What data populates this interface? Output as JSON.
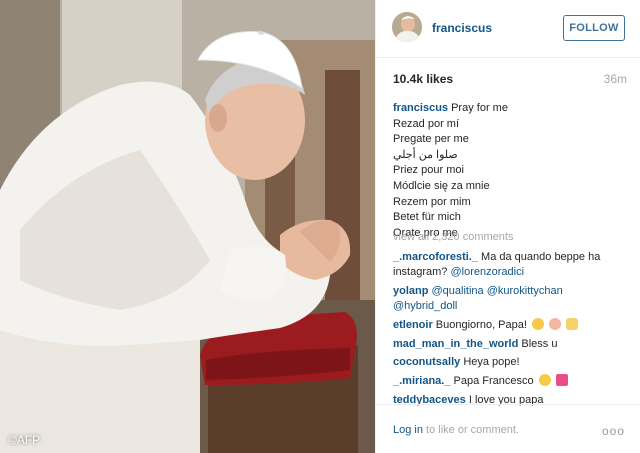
{
  "photo": {
    "credit": "©AFP"
  },
  "header": {
    "username": "franciscus",
    "follow_label": "FOLLOW"
  },
  "stats": {
    "likes": "10.4k likes",
    "time": "36m"
  },
  "caption": {
    "username": "franciscus",
    "lines": [
      "Pray for me",
      "Rezad por mí",
      "Pregate per me",
      "صلوا من أجلي",
      "Priez pour moi",
      "Módlcie się za mnie",
      "Rezem por mim",
      "Betet für mich",
      "Orate pro me"
    ]
  },
  "view_all": "view all 2,320 comments",
  "comments": [
    {
      "user": "_.marcoforesti._",
      "text": "Ma da quando beppe ha instagram?",
      "mentions": [
        "@lorenzoradici"
      ]
    },
    {
      "user": "yolanp",
      "text": "",
      "mentions": [
        "@qualitina",
        "@kurokittychan",
        "@hybrid_doll"
      ]
    },
    {
      "user": "etlenoir",
      "text": "Buongiorno, Papa!",
      "mentions": []
    },
    {
      "user": "mad_man_in_the_world",
      "text": "Bless u",
      "mentions": []
    },
    {
      "user": "coconutsally",
      "text": "Heya pope!",
      "mentions": []
    },
    {
      "user": "_.miriana._",
      "text": "Papa Francesco",
      "mentions": []
    },
    {
      "user": "teddybaceves",
      "text": "I love you papa",
      "mentions": []
    }
  ],
  "footer": {
    "login_link": "Log in",
    "login_rest": "to like or comment.",
    "more": "ooo"
  },
  "colors": {
    "link": "#125688",
    "follow": "#3f729b",
    "muted": "#a5a7aa",
    "text": "#262626"
  },
  "icons": [
    "more-options-icon"
  ]
}
